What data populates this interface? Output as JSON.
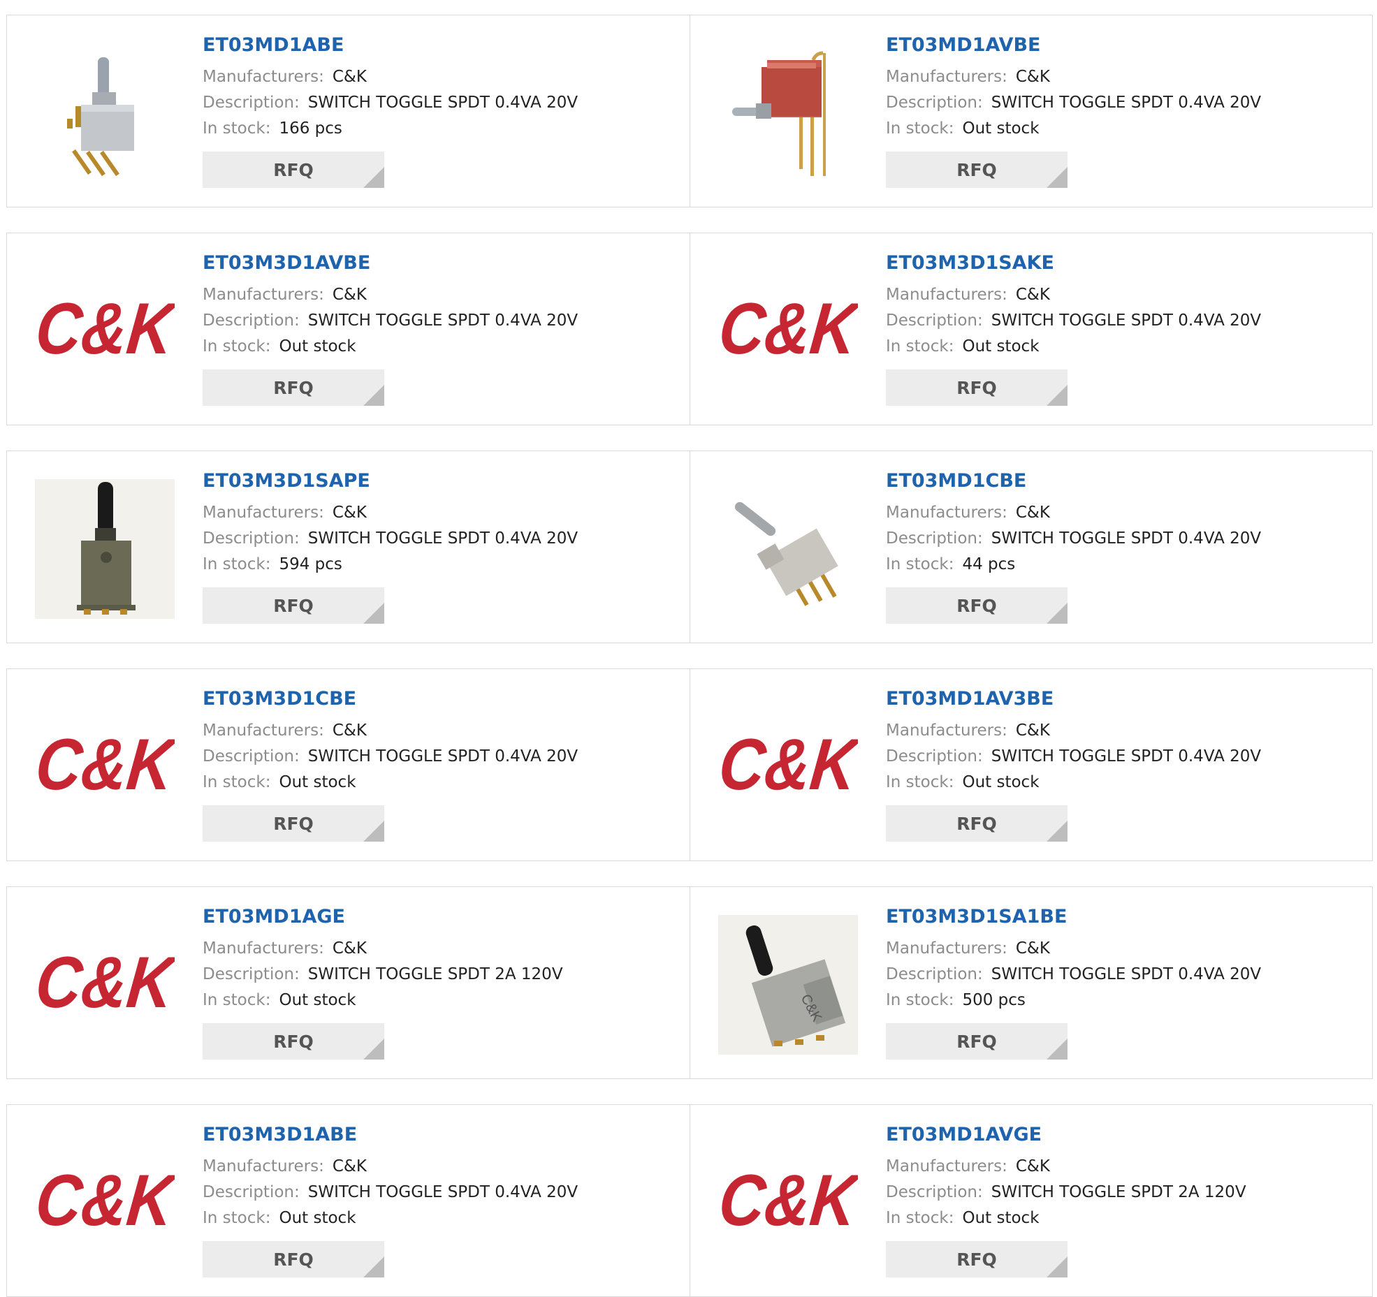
{
  "labels": {
    "manufacturers": "Manufacturers:",
    "description": "Description:",
    "in_stock": "In stock:",
    "rfq": "RFQ"
  },
  "colors": {
    "part_link": "#1f63ad",
    "label": "#8c8c8c",
    "value": "#222222",
    "rfq_bg": "#ececec",
    "ck_logo_red": "#c62631"
  },
  "products": [
    {
      "part": "ET03MD1ABE",
      "manufacturer": "C&K",
      "description": "SWITCH TOGGLE SPDT 0.4VA 20V",
      "stock": "166 pcs",
      "image": "gray-right-angle-toggle-switch"
    },
    {
      "part": "ET03MD1AVBE",
      "manufacturer": "C&K",
      "description": "SWITCH TOGGLE SPDT 0.4VA 20V",
      "stock": "Out stock",
      "image": "red-vertical-toggle-switch"
    },
    {
      "part": "ET03M3D1AVBE",
      "manufacturer": "C&K",
      "description": "SWITCH TOGGLE SPDT 0.4VA 20V",
      "stock": "Out stock",
      "image": "ck-logo"
    },
    {
      "part": "ET03M3D1SAKE",
      "manufacturer": "C&K",
      "description": "SWITCH TOGGLE SPDT 0.4VA 20V",
      "stock": "Out stock",
      "image": "ck-logo"
    },
    {
      "part": "ET03M3D1SAPE",
      "manufacturer": "C&K",
      "description": "SWITCH TOGGLE SPDT 0.4VA 20V",
      "stock": "594 pcs",
      "image": "dark-smd-toggle-switch"
    },
    {
      "part": "ET03MD1CBE",
      "manufacturer": "C&K",
      "description": "SWITCH TOGGLE SPDT 0.4VA 20V",
      "stock": "44 pcs",
      "image": "beige-angled-toggle-switch"
    },
    {
      "part": "ET03M3D1CBE",
      "manufacturer": "C&K",
      "description": "SWITCH TOGGLE SPDT 0.4VA 20V",
      "stock": "Out stock",
      "image": "ck-logo"
    },
    {
      "part": "ET03MD1AV3BE",
      "manufacturer": "C&K",
      "description": "SWITCH TOGGLE SPDT 0.4VA 20V",
      "stock": "Out stock",
      "image": "ck-logo"
    },
    {
      "part": "ET03MD1AGE",
      "manufacturer": "C&K",
      "description": "SWITCH TOGGLE SPDT 2A 120V",
      "stock": "Out stock",
      "image": "ck-logo"
    },
    {
      "part": "ET03M3D1SA1BE",
      "manufacturer": "C&K",
      "description": "SWITCH TOGGLE SPDT 0.4VA 20V",
      "stock": "500 pcs",
      "image": "gray-smd-toggle-switch"
    },
    {
      "part": "ET03M3D1ABE",
      "manufacturer": "C&K",
      "description": "SWITCH TOGGLE SPDT 0.4VA 20V",
      "stock": "Out stock",
      "image": "ck-logo"
    },
    {
      "part": "ET03MD1AVGE",
      "manufacturer": "C&K",
      "description": "SWITCH TOGGLE SPDT 2A 120V",
      "stock": "Out stock",
      "image": "ck-logo"
    }
  ]
}
